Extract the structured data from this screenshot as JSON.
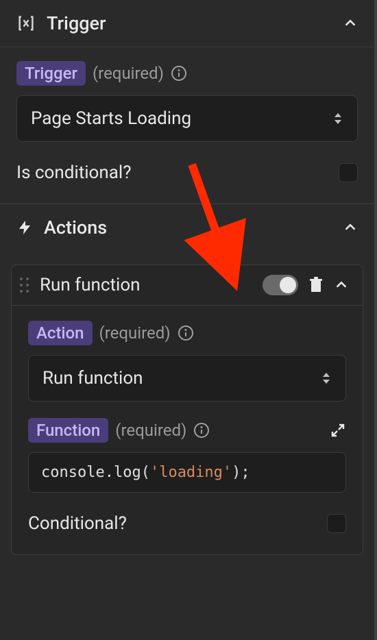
{
  "trigger": {
    "section_title": "Trigger",
    "field_label": "Trigger",
    "required_text": "(required)",
    "select_value": "Page Starts Loading",
    "conditional_label": "Is conditional?"
  },
  "actions": {
    "section_title": "Actions",
    "item": {
      "title": "Run function",
      "action_label": "Action",
      "action_required": "(required)",
      "action_value": "Run function",
      "function_label": "Function",
      "function_required": "(required)",
      "code_prefix": "console.log(",
      "code_string": "'loading'",
      "code_suffix": ");",
      "conditional_label": "Conditional?"
    }
  }
}
